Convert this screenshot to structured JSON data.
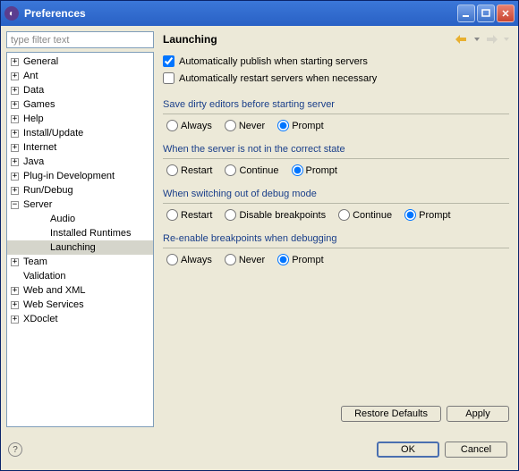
{
  "window": {
    "title": "Preferences"
  },
  "filter": {
    "placeholder": "type filter text"
  },
  "tree": {
    "items": [
      {
        "label": "General",
        "exp": "+",
        "depth": 0
      },
      {
        "label": "Ant",
        "exp": "+",
        "depth": 0
      },
      {
        "label": "Data",
        "exp": "+",
        "depth": 0
      },
      {
        "label": "Games",
        "exp": "+",
        "depth": 0
      },
      {
        "label": "Help",
        "exp": "+",
        "depth": 0
      },
      {
        "label": "Install/Update",
        "exp": "+",
        "depth": 0
      },
      {
        "label": "Internet",
        "exp": "+",
        "depth": 0
      },
      {
        "label": "Java",
        "exp": "+",
        "depth": 0
      },
      {
        "label": "Plug-in Development",
        "exp": "+",
        "depth": 0
      },
      {
        "label": "Run/Debug",
        "exp": "+",
        "depth": 0
      },
      {
        "label": "Server",
        "exp": "−",
        "depth": 0
      },
      {
        "label": "Audio",
        "exp": "",
        "depth": 1
      },
      {
        "label": "Installed Runtimes",
        "exp": "",
        "depth": 1
      },
      {
        "label": "Launching",
        "exp": "",
        "depth": 1,
        "selected": true
      },
      {
        "label": "Team",
        "exp": "+",
        "depth": 0
      },
      {
        "label": "Validation",
        "exp": "",
        "depth": 0
      },
      {
        "label": "Web and XML",
        "exp": "+",
        "depth": 0
      },
      {
        "label": "Web Services",
        "exp": "+",
        "depth": 0
      },
      {
        "label": "XDoclet",
        "exp": "+",
        "depth": 0
      }
    ]
  },
  "page": {
    "title": "Launching",
    "checkAutoPublish": "Automatically publish when starting servers",
    "checkAutoRestart": "Automatically restart servers when necessary",
    "group1": {
      "title": "Save dirty editors before starting server",
      "opts": [
        "Always",
        "Never",
        "Prompt"
      ],
      "sel": 2
    },
    "group2": {
      "title": "When the server is not in the correct state",
      "opts": [
        "Restart",
        "Continue",
        "Prompt"
      ],
      "sel": 2
    },
    "group3": {
      "title": "When switching out of debug mode",
      "opts": [
        "Restart",
        "Disable breakpoints",
        "Continue",
        "Prompt"
      ],
      "sel": 3
    },
    "group4": {
      "title": "Re-enable breakpoints when debugging",
      "opts": [
        "Always",
        "Never",
        "Prompt"
      ],
      "sel": 2
    }
  },
  "buttons": {
    "restoreDefaults": "Restore Defaults",
    "apply": "Apply",
    "ok": "OK",
    "cancel": "Cancel"
  }
}
